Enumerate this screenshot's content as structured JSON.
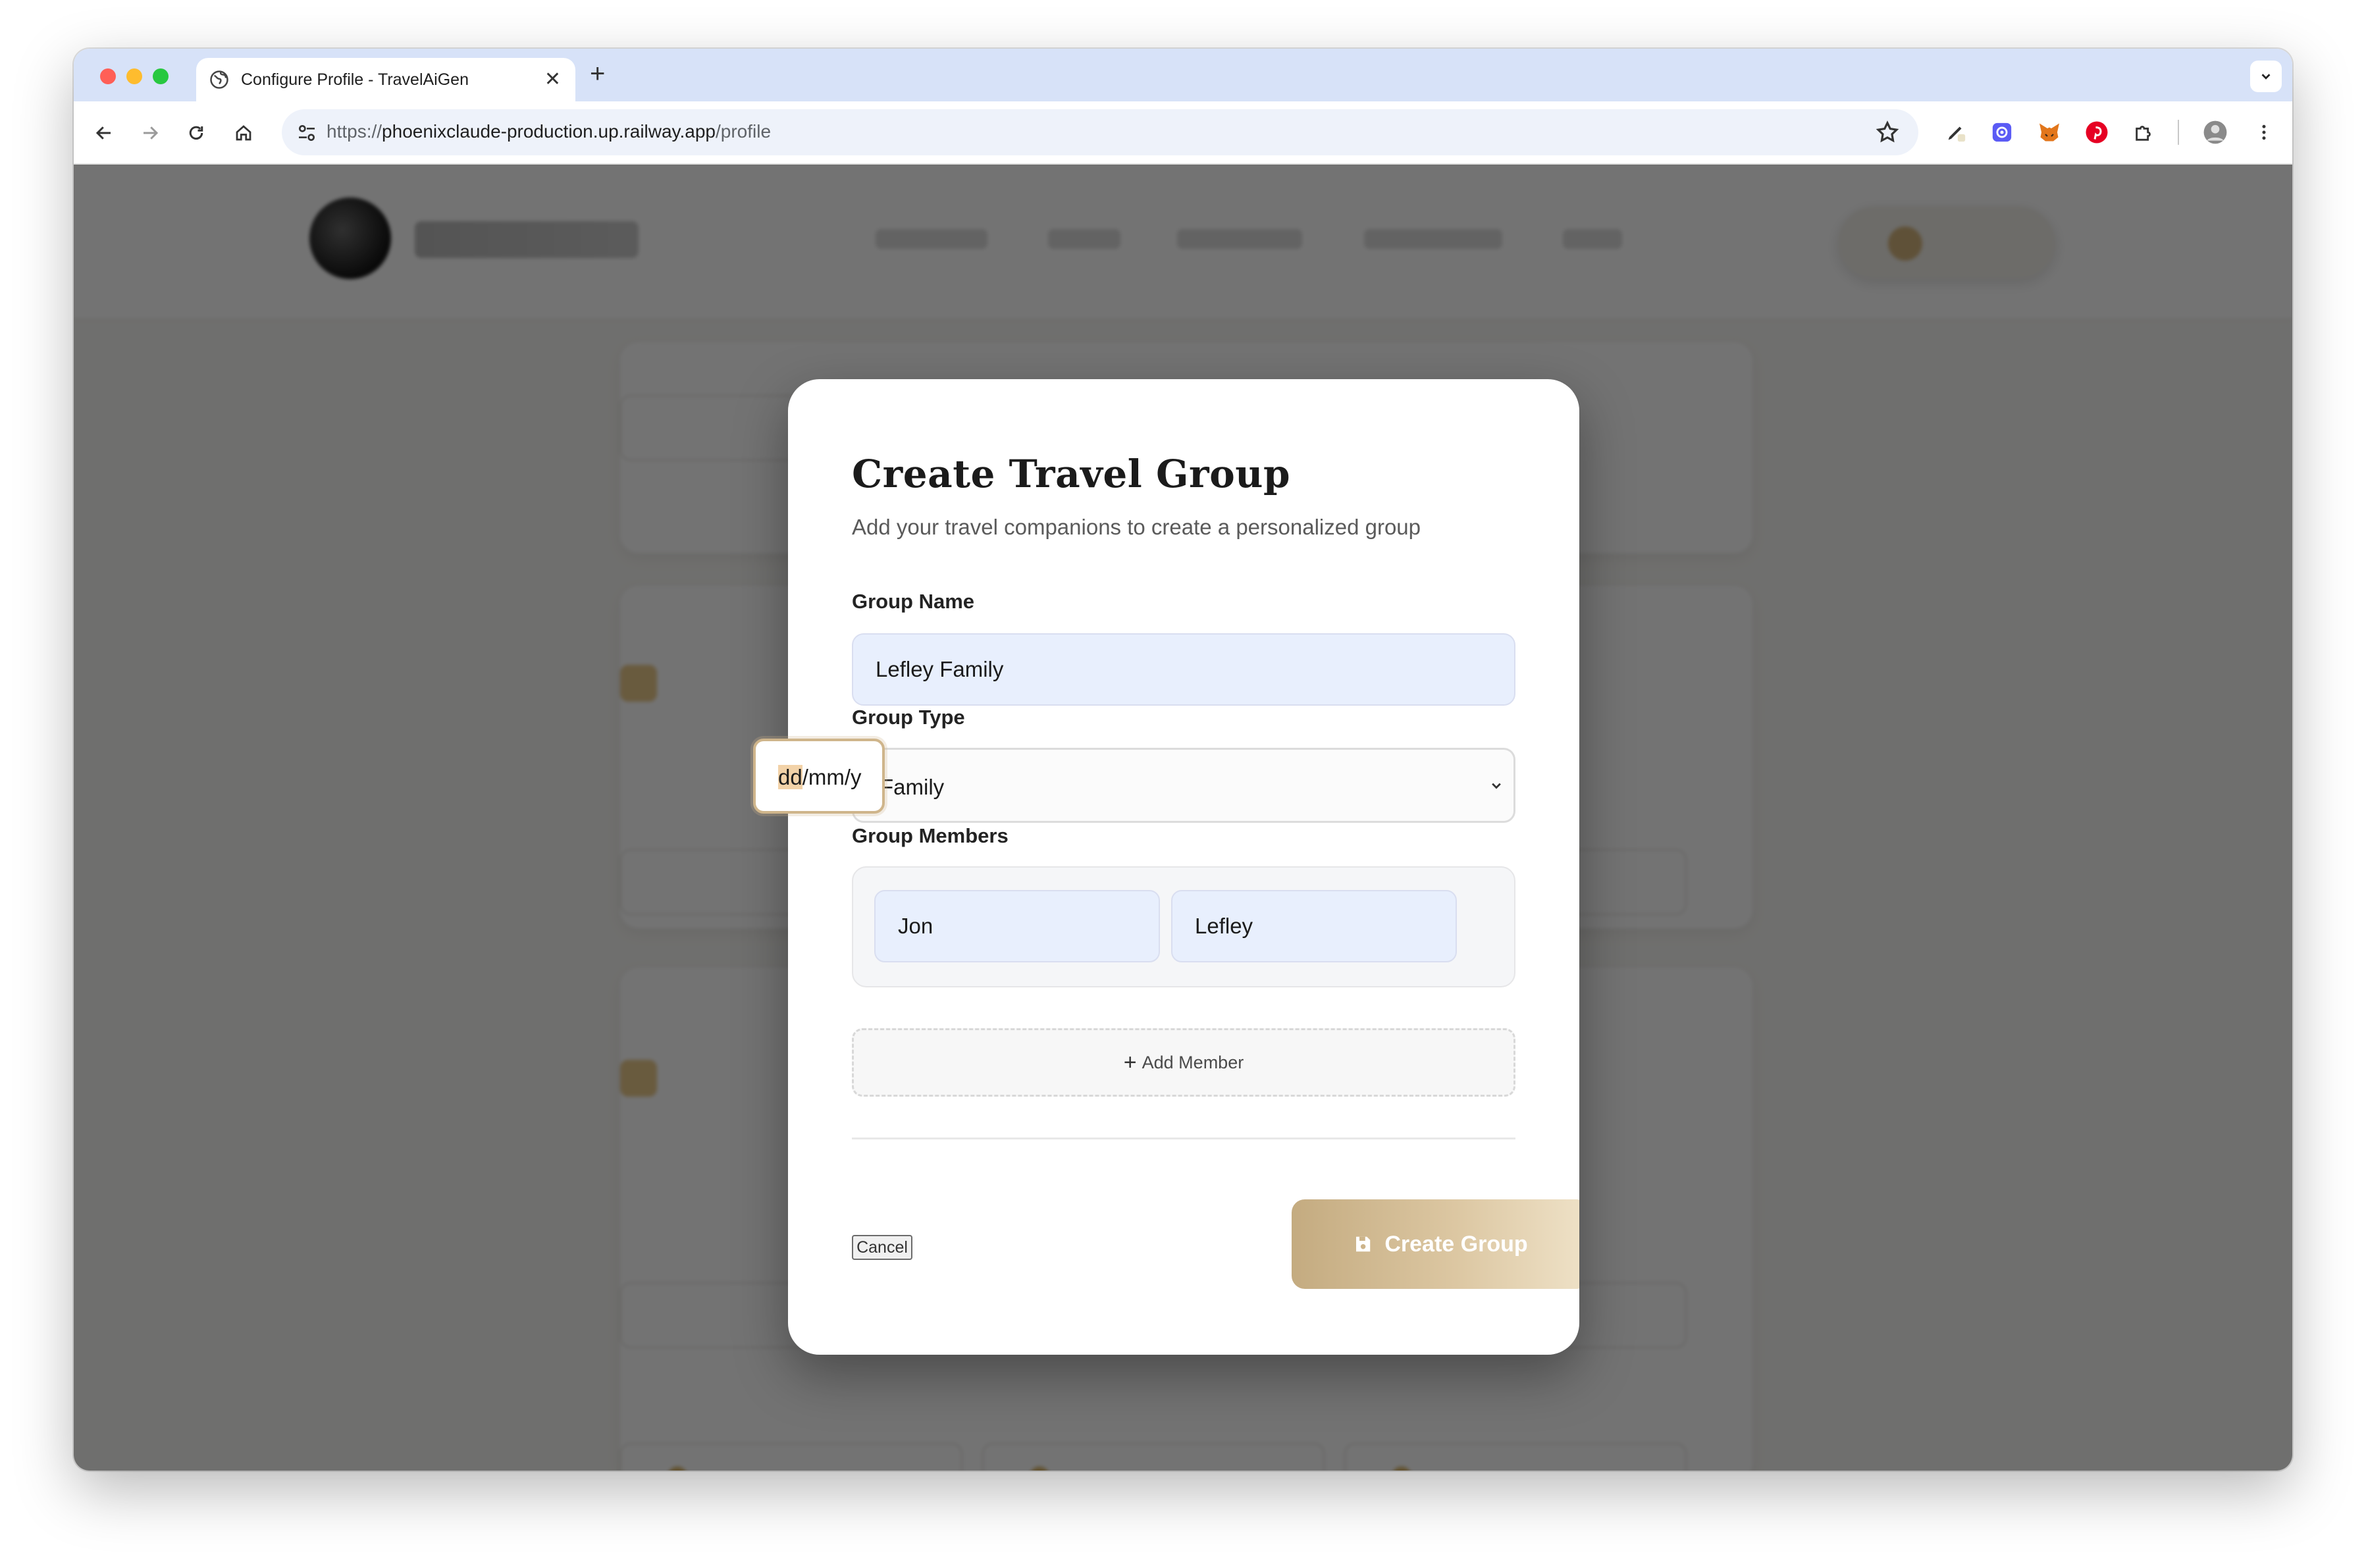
{
  "browser": {
    "tab_title": "Configure Profile - TravelAiGen",
    "url_scheme": "https://",
    "url_host": "phoenixclaude-production.up.railway.app",
    "url_path": "/profile",
    "icons": [
      "globe-icon",
      "close-icon",
      "plus-icon",
      "chevron-down-icon",
      "back-arrow-icon",
      "forward-arrow-icon",
      "reload-icon",
      "home-icon",
      "site-settings-icon",
      "bookmark-star-icon",
      "pen-extension-icon",
      "ai-extension-icon",
      "metamask-fox-icon",
      "pinterest-icon",
      "puzzle-extensions-icon",
      "profile-avatar-icon",
      "kebab-menu-icon"
    ]
  },
  "modal": {
    "title": "Create Travel Group",
    "subtitle": "Add your travel companions to create a personalized group",
    "group_name_label": "Group Name",
    "group_name_value": "Lefley Family",
    "group_type_label": "Group Type",
    "group_type_value": "Family",
    "members_label": "Group Members",
    "members": [
      {
        "first_name": "Jon",
        "last_name": "Lefley",
        "dob_placeholder_day": "dd",
        "dob_placeholder_rest": "/mm/y"
      }
    ],
    "add_member_label": "Add Member",
    "cancel_label": "Cancel",
    "create_label": "Create Group"
  },
  "colors": {
    "accent_gold": "#c4ab80",
    "input_fill": "#e8effd",
    "overlay": "rgba(0,0,0,0.55)"
  }
}
